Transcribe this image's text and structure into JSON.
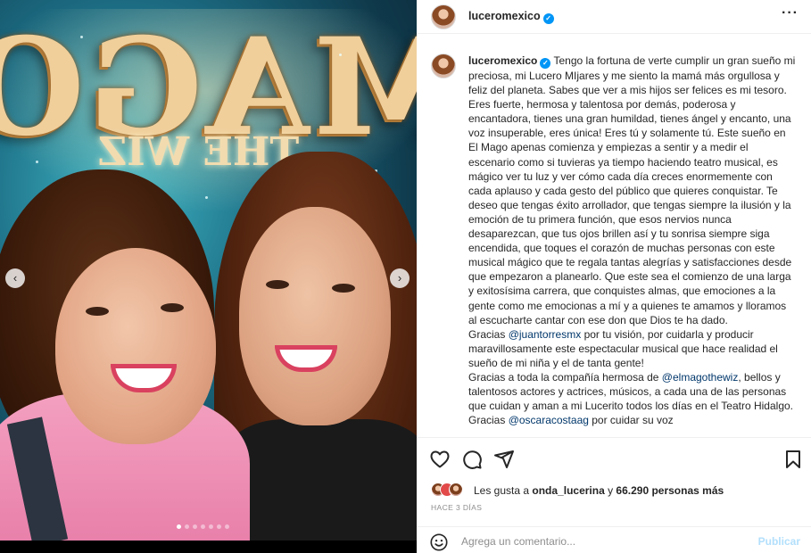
{
  "media": {
    "poster_title": "MAGO",
    "poster_subtitle": "THE WIZ",
    "carousel": {
      "total": 7,
      "active_index": 0
    },
    "prev_icon": "chevron-left-icon",
    "next_icon": "chevron-right-icon"
  },
  "header": {
    "username": "luceromexico",
    "more_icon": "more-horizontal-icon"
  },
  "caption": {
    "username": "luceromexico",
    "p1": "Tengo la fortuna de verte cumplir un gran sueño mi preciosa, mi Lucero MIjares y me siento la mamá más orgullosa y feliz del planeta. Sabes que ver a mis hijos ser felices es mi tesoro. Eres fuerte, hermosa y talentosa por demás, poderosa y encantadora, tienes una gran humildad, tienes ángel y encanto, una voz insuperable, eres única! Eres tú y solamente tú. Este sueño en El Mago apenas comienza y empiezas a sentir y a medir el escenario como si tuvieras ya tiempo haciendo teatro musical, es mágico ver tu luz y ver cómo cada día creces enormemente con cada aplauso y cada gesto del público que quieres conquistar. Te deseo que tengas éxito arrollador, que tengas siempre la ilusión y la emoción de tu primera función, que esos nervios nunca desaparezcan, que tus ojos brillen así y tu sonrisa siempre siga encendida, que toques el corazón de muchas personas con este musical mágico que te regala tantas alegrías y satisfacciones desde que empezaron a planearlo. Que este sea el comienzo de una larga y exitosísima carrera, que conquistes almas, que emociones a la gente como me emocionas a mí y a quienes te amamos y lloramos al escucharte cantar con ese don que Dios te ha dado.",
    "p2_before": "Gracias ",
    "p2_mention": "@juantorresmx",
    "p2_after": " por tu visión, por cuidarla y producir maravillosamente este espectacular musical que hace realidad el sueño de mi niña y el de tanta gente!",
    "p3_before": "Gracias a toda la compañía hermosa de ",
    "p3_mention": "@elmagothewiz",
    "p3_after": ", bellos y talentosos actores y actrices, músicos, a cada una de las personas que cuidan y aman a mi Lucerito todos los días en el Teatro Hidalgo. Gracias ",
    "p3_mention2": "@oscaracostaag",
    "p3_tail": " por cuidar su voz"
  },
  "actions": {
    "like_icon": "heart-icon",
    "comment_icon": "comment-icon",
    "share_icon": "send-icon",
    "save_icon": "bookmark-icon",
    "likes_prefix": "Les gusta a ",
    "likes_user": "onda_lucerina",
    "likes_middle": " y ",
    "likes_count": "66.290 personas más",
    "timestamp": "HACE 3 DÍAS"
  },
  "comment": {
    "emoji_icon": "emoji-icon",
    "placeholder": "Agrega un comentario...",
    "publish_label": "Publicar"
  },
  "colors": {
    "verified": "#0095f6",
    "mention": "#00376b",
    "publish_disabled": "#b2dffc",
    "muted": "#8e8e8e"
  }
}
